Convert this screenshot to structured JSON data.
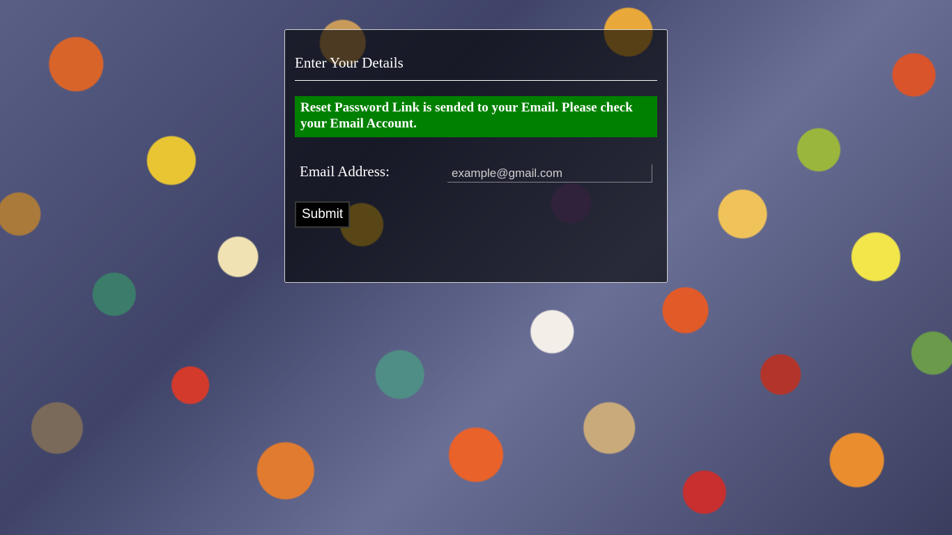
{
  "panel": {
    "title": "Enter Your Details",
    "alert_message": "Reset Password Link is sended to your Email. Please check your Email Account.",
    "alert_color": "#008000"
  },
  "form": {
    "email_label": "Email Address:",
    "email_placeholder": "example@gmail.com",
    "email_value": "",
    "submit_label": "Submit"
  }
}
